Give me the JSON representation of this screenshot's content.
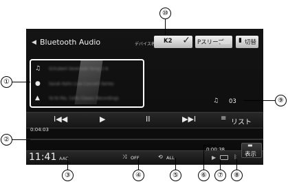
{
  "header": {
    "back_icon": "back-arrow-icon",
    "source_title": "Bluetooth Audio",
    "device_label": "デバイス名",
    "device_name": "K2",
    "sleep_label": "Pスリープ",
    "switch_label": "切替"
  },
  "track": {
    "rows": [
      {
        "icon": "music-note-icon",
        "text": "Schubert Serenade Song 2 A"
      },
      {
        "icon": "disc-icon",
        "text": "Sarah Kahn Live Concert Series"
      },
      {
        "icon": "artist-icon",
        "text": "Yo-Yo Ma, Cello Classic Recordings"
      }
    ],
    "number": "03"
  },
  "transport": {
    "prev": "I◀◀",
    "play": "▶",
    "pause": "II",
    "next": "▶▶I",
    "list_label": "リスト"
  },
  "progress": {
    "elapsed": "0:04:03",
    "total": "0:00:38"
  },
  "status": {
    "clock": "11:41",
    "codec": "AAC",
    "shuffle": "OFF",
    "repeat": "ALL",
    "display_label": "表示"
  },
  "callouts": [
    "①",
    "②",
    "③",
    "④",
    "⑤",
    "⑥",
    "⑦",
    "⑧",
    "⑨",
    "⑩"
  ]
}
